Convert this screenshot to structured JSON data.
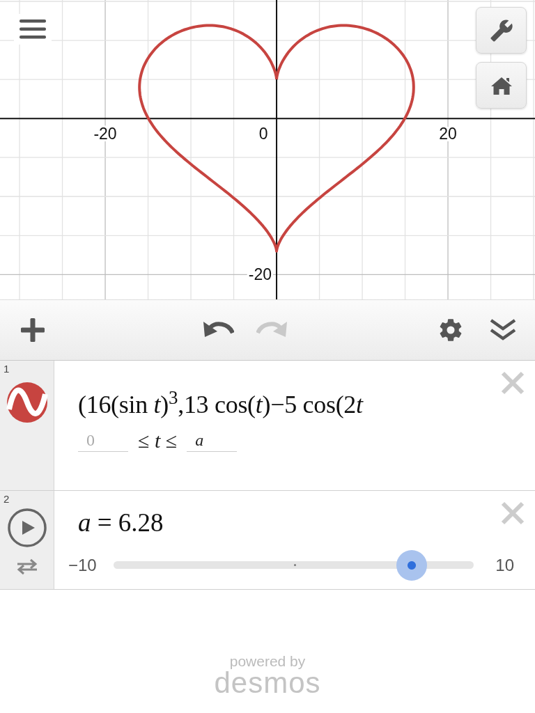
{
  "graph": {
    "x_axis_labels": [
      "-20",
      "0",
      "20"
    ],
    "y_axis_labels": [
      "-20"
    ]
  },
  "toolbar": [
    {
      "kind": "add",
      "disabled": false
    },
    {
      "kind": "undo",
      "disabled": false
    },
    {
      "kind": "redo",
      "disabled": true
    },
    {
      "kind": "settings",
      "disabled": false
    },
    {
      "kind": "collapse",
      "disabled": false
    }
  ],
  "expressions": [
    {
      "number": "1",
      "kind": "curve",
      "color": "#c74440",
      "formula": [
        {
          "kind": "plain",
          "text": "(16(sin "
        },
        {
          "kind": "var",
          "text": "t"
        },
        {
          "kind": "plain",
          "text": ")"
        },
        {
          "kind": "sup",
          "text": "3"
        },
        {
          "kind": "plain",
          "text": ",13 cos("
        },
        {
          "kind": "var",
          "text": "t"
        },
        {
          "kind": "plain",
          "text": ")−5 cos(2"
        },
        {
          "kind": "var",
          "text": "t"
        }
      ],
      "domain": {
        "min_placeholder": "0",
        "between": "≤ *t* ≤",
        "max": "a"
      }
    },
    {
      "number": "2",
      "kind": "slider",
      "formula": "*a* = 6.28",
      "min": "−10",
      "max": "10",
      "level": 0.814
    }
  ],
  "footer": {
    "tagline": "powered by",
    "brand": "desmos"
  }
}
